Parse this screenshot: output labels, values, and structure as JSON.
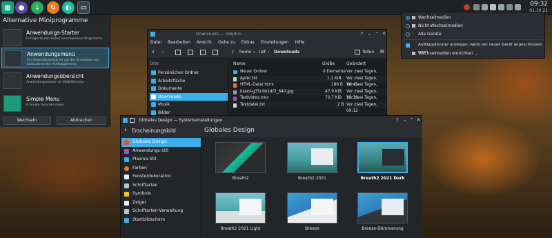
{
  "panel": {
    "apps": [
      {
        "name": "app-launcher",
        "color": "#16a085"
      },
      {
        "name": "firefox",
        "color": "#e66000"
      },
      {
        "name": "downloader",
        "color": "#27ae60"
      },
      {
        "name": "updater",
        "color": "#1abc9c"
      },
      {
        "name": "terminal",
        "color": "#2c3e50"
      }
    ],
    "clock_time": "09:32",
    "clock_date": "01.10.21"
  },
  "alt_widgets": {
    "title": "Alternative Miniprogramme",
    "items": [
      {
        "title": "Anwendungs-Starter",
        "desc": "Ermöglicht den Aufruf verschiedener Programme"
      },
      {
        "title": "Anwendungsmenü",
        "desc": "Ein Anwendungsstarter auf der Grundlage von kaskadierenden Aufklappmenüs"
      },
      {
        "title": "Anwendungsübersicht",
        "desc": "Anwendungsstarter im Vollbildmodus"
      },
      {
        "title": "Simple Menu",
        "desc": "A simple launcher menu"
      }
    ],
    "switch_label": "Wechseln",
    "cancel_label": "Abbrechen"
  },
  "dolphin": {
    "title": "Downloads — Dolphin",
    "menu": [
      "Datei",
      "Bearbeiten",
      "Ansicht",
      "Gehe zu",
      "Extras",
      "Einstellungen",
      "Hilfe"
    ],
    "breadcrumb": [
      "home",
      "ralf",
      "Downloads"
    ],
    "share_label": "Teilen",
    "places_header": "Orte",
    "places": [
      "Persönlicher Ordner",
      "Arbeitsfläche",
      "Dokumente",
      "Downloads",
      "Musik",
      "Bilder"
    ],
    "columns": {
      "name": "Name",
      "size": "Größe",
      "modified": "Geändert"
    },
    "files": [
      {
        "name": "Neuer Ordner",
        "size": "0 Elemente",
        "modified": "Vor zwei Tagen, 09:12"
      },
      {
        "name": "Apfel.txt",
        "size": "1,1 KiB",
        "modified": "Vor zwei Tagen, 16:41"
      },
      {
        "name": "HTML-Datei.html",
        "size": "186 B",
        "modified": "Vor zwei Tagen, 09:12"
      },
      {
        "name": "lizard-g35cbb14f2_640.jpg",
        "size": "47,9 KiB",
        "modified": "Vor zwei Tagen, 15:31"
      },
      {
        "name": "TestVideo.mkv",
        "size": "70,7 KiB",
        "modified": "Vor zwei Tagen, 09:11"
      },
      {
        "name": "Textdatei.txt",
        "size": "2 B",
        "modified": "Vor zwei Tagen, 09:12"
      }
    ]
  },
  "devices": {
    "options": [
      "Wechselmedien",
      "Nicht-Wechselmedien",
      "Alle Geräte"
    ],
    "checkbox_label": "Aufklappfenster anzeigen, wenn ein neues Gerät angeschlossen wird",
    "configure_label": "Wechselmedien einrichten ..."
  },
  "settings": {
    "title": "Globales Design — Systemeinstellungen",
    "section_back": "Erscheinungsbild",
    "page_title": "Globales Design",
    "sidebar": [
      "Globales Design",
      "Anwendungs-Stil",
      "Plasma-Stil",
      "Farben",
      "Fensterdekoration",
      "Schriftarten",
      "Symbole",
      "Zeiger",
      "Schriftarten-Verwaltung",
      "Startbildschirm"
    ],
    "themes": [
      "Breath2",
      "Breath2 2021",
      "Breath2 2021 Dark",
      "Breath2 2021 Light",
      "Breeze",
      "Breeze-Dämmerung"
    ]
  }
}
